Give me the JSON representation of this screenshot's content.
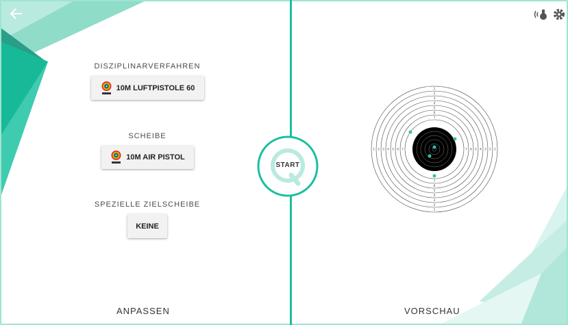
{
  "header": {
    "back_icon": "arrow-left-icon",
    "icons": [
      "wireless-remote-icon",
      "settings-gear-icon"
    ]
  },
  "left_panel": {
    "discipline": {
      "label": "DISZIPLINARVERFAHREN",
      "value": "10M LUFTPISTOLE 60",
      "logo": "issf-logo"
    },
    "target": {
      "label": "SCHEIBE",
      "value": "10M AIR PISTOL",
      "logo": "issf-logo"
    },
    "special_target": {
      "label": "SPEZIELLE ZIELSCHEIBE",
      "value": "KEINE"
    },
    "footer": "ANPASSEN"
  },
  "start_button": {
    "label": "START"
  },
  "right_panel": {
    "footer": "VORSCHAU",
    "ring_numbers": [
      "1",
      "2",
      "3",
      "4",
      "5",
      "6",
      "7",
      "8"
    ]
  },
  "colors": {
    "accent": "#19bfa0",
    "accent_light": "#9fe4d3",
    "shot_marker": "#2fc1ae",
    "target_black": "#000000"
  }
}
